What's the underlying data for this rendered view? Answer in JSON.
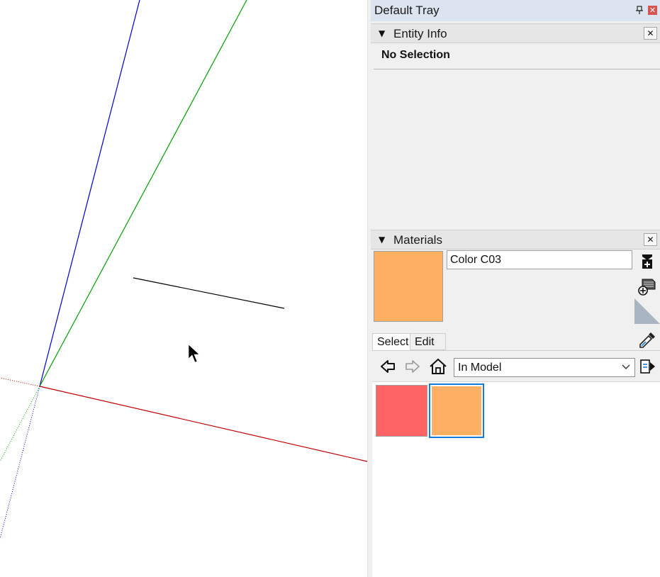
{
  "tray": {
    "title": "Default Tray",
    "close_glyph": "✕"
  },
  "entity_info": {
    "title": "Entity Info",
    "collapse_glyph": "▼",
    "close_glyph": "✕",
    "status": "No Selection"
  },
  "materials": {
    "title": "Materials",
    "collapse_glyph": "▼",
    "close_glyph": "✕",
    "material_name": "Color C03",
    "current_color": "#ffb063",
    "tabs": [
      {
        "label": "Select",
        "active": true
      },
      {
        "label": "Edit",
        "active": false
      }
    ],
    "collection": "In Model",
    "swatches": [
      {
        "color": "#ff6464",
        "selected": false
      },
      {
        "color": "#ffb063",
        "selected": true
      }
    ]
  },
  "viewport": {
    "axis_colors": {
      "blue": "#0000c8",
      "green": "#00a000",
      "red": "#c00000"
    },
    "line_color": "#000000"
  },
  "colors": {
    "tray_bg": "#f0f0f0",
    "title_bar_bg": "#dbe4ef",
    "selection_accent": "#1a7ad8"
  }
}
